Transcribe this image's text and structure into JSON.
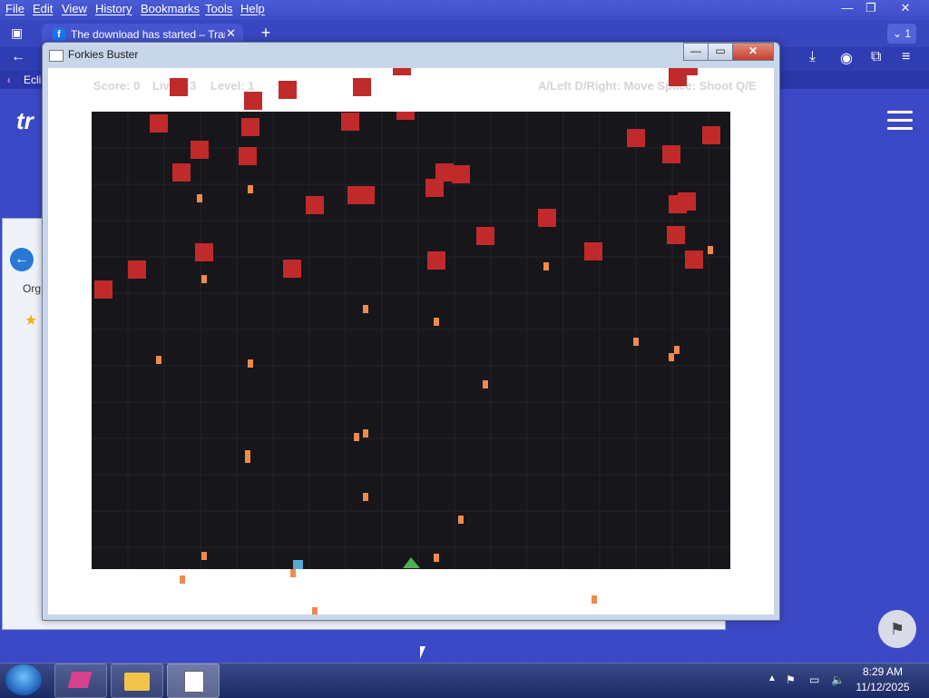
{
  "browser": {
    "menu": [
      "File",
      "Edit",
      "View",
      "History",
      "Bookmarks",
      "Tools",
      "Help"
    ],
    "tab_title": "The download has started – Trar",
    "tab_icon": "f",
    "tab_close": "✕",
    "new_tab": "+",
    "tab_count": "1",
    "bookmark_label": "Ecli",
    "site_logo": "tr",
    "accent": "#3e4fc4"
  },
  "explorer": {
    "organize_label": "Org"
  },
  "game": {
    "window_title": "Forkies Buster",
    "hud": {
      "score": "Score: 0",
      "lives": "Lives: 3",
      "level": "Level: 1",
      "controls": "A/Left D/Right: Move   Space: Shoot   Q/E"
    },
    "colors": {
      "enemy": "#c12a2a",
      "bullet": "#f08a4b",
      "player": "#4caf50",
      "powerup": "#56a8d8",
      "field": "#16161b"
    }
  },
  "taskbar": {
    "time": "8:29 AM",
    "date": "11/12/2025"
  }
}
